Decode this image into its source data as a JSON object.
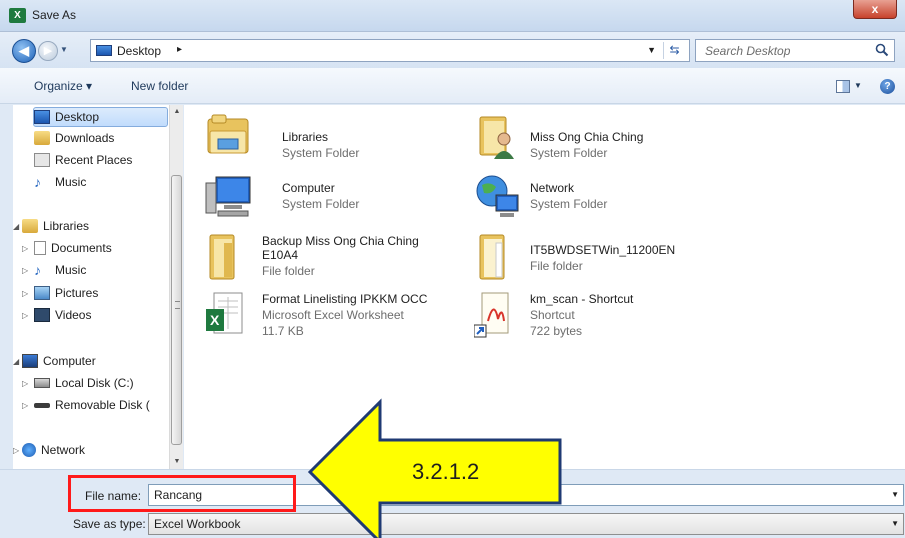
{
  "window": {
    "title": "Save As",
    "app_icon": "X",
    "close_glyph": "x"
  },
  "address": {
    "location": "Desktop",
    "separator": "▸",
    "search_placeholder": "Search Desktop"
  },
  "toolbar": {
    "organize_label": "Organize ▾",
    "new_folder_label": "New folder"
  },
  "navigation": {
    "favorites": [
      {
        "label": "Desktop",
        "icon": "desktop-icon",
        "selected": true
      },
      {
        "label": "Downloads",
        "icon": "downloads-icon"
      },
      {
        "label": "Recent Places",
        "icon": "recent-places-icon"
      },
      {
        "label": "Music",
        "icon": "music-icon"
      }
    ],
    "libraries": {
      "label": "Libraries",
      "items": [
        "Documents",
        "Music",
        "Pictures",
        "Videos"
      ]
    },
    "computer": {
      "label": "Computer",
      "items": [
        "Local Disk (C:)",
        "Removable Disk ("
      ]
    },
    "network": {
      "label": "Network"
    }
  },
  "items": [
    {
      "name": "Libraries",
      "sub1": "System Folder",
      "sub2": "",
      "icon": "libraries-folder-icon"
    },
    {
      "name": "Miss Ong Chia Ching",
      "sub1": "System Folder",
      "sub2": "",
      "icon": "user-folder-icon"
    },
    {
      "name": "Computer",
      "sub1": "System Folder",
      "sub2": "",
      "icon": "computer-icon"
    },
    {
      "name": "Network",
      "sub1": "System Folder",
      "sub2": "",
      "icon": "network-globe-icon"
    },
    {
      "name": "Backup Miss Ong Chia Ching E10A4",
      "sub1": "File folder",
      "sub2": "",
      "icon": "folder-icon"
    },
    {
      "name": "IT5BWDSETWin_11200EN",
      "sub1": "File folder",
      "sub2": "",
      "icon": "folder-icon"
    },
    {
      "name": "Format Linelisting IPKKM OCC",
      "sub1": "Microsoft Excel Worksheet",
      "sub2": "11.7 KB",
      "icon": "excel-file-icon"
    },
    {
      "name": "km_scan - Shortcut",
      "sub1": "Shortcut",
      "sub2": "722 bytes",
      "icon": "pdf-shortcut-icon"
    }
  ],
  "form": {
    "file_name_label": "File name:",
    "file_name_value": "Rancang",
    "save_type_label": "Save as type:",
    "save_type_value": "Excel Workbook"
  },
  "annotation": {
    "step_label": "3.2.1.2",
    "arrow_color": "#ffff00",
    "highlight_color": "#ff1a1a"
  }
}
